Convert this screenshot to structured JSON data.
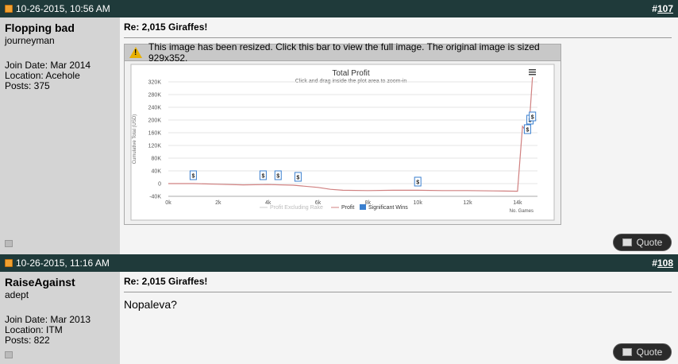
{
  "posts": [
    {
      "date": "10-26-2015, 10:56 AM",
      "number": "107",
      "user": {
        "name": "Flopping bad",
        "title": "journeyman",
        "join": "Join Date: Mar 2014",
        "location": "Location: Acehole",
        "posts": "Posts: 375"
      },
      "title": "Re: 2,015 Giraffes!",
      "resize_notice": "This image has been resized. Click this bar to view the full image. The original image is sized 929x352.",
      "quote_label": "Quote"
    },
    {
      "date": "10-26-2015, 11:16 AM",
      "number": "108",
      "user": {
        "name": "RaiseAgainst",
        "title": "adept",
        "join": "Join Date: Mar 2013",
        "location": "Location: ITM",
        "posts": "Posts: 822"
      },
      "title": "Re: 2,015 Giraffes!",
      "message": "Nopaleva?",
      "quote_label": "Quote"
    }
  ],
  "chart_data": {
    "type": "line",
    "title": "Total Profit",
    "subtitle": "Click and drag inside the plot area to zoom-in",
    "ylabel": "Cumulative Total (USD)",
    "xlabel_corner": "No. Games",
    "ylim": [
      -40000,
      320000
    ],
    "xlim": [
      0,
      14800
    ],
    "yticks": [
      "320K",
      "280K",
      "240K",
      "200K",
      "160K",
      "120K",
      "80K",
      "40K",
      "0",
      "-40K"
    ],
    "ytick_values": [
      320000,
      280000,
      240000,
      200000,
      160000,
      120000,
      80000,
      40000,
      0,
      -40000
    ],
    "xticks": [
      "0k",
      "2k",
      "4k",
      "6k",
      "8k",
      "10k",
      "12k",
      "14k"
    ],
    "xtick_values": [
      0,
      2000,
      4000,
      6000,
      8000,
      10000,
      12000,
      14000
    ],
    "legend": [
      "Profit Excluding Rake",
      "Profit",
      "Significant Wins"
    ],
    "series": [
      {
        "name": "Profit",
        "color": "#d08080",
        "x": [
          0,
          1000,
          2000,
          3000,
          4000,
          5000,
          6000,
          6500,
          7000,
          8000,
          9000,
          10000,
          11000,
          12000,
          13000,
          14000,
          14200,
          14300,
          14500,
          14600
        ],
        "y": [
          0,
          0,
          -2000,
          -4000,
          -3000,
          -5000,
          -12000,
          -18000,
          -21000,
          -22000,
          -21000,
          -21000,
          -22000,
          -22000,
          -23000,
          -24000,
          180000,
          170000,
          220000,
          340000
        ]
      }
    ],
    "markers": {
      "label": "$",
      "x": [
        1000,
        3800,
        4400,
        5200,
        10000,
        14400,
        14500,
        14600
      ],
      "y": [
        25000,
        25000,
        25000,
        20000,
        5000,
        170000,
        200000,
        210000
      ]
    }
  }
}
